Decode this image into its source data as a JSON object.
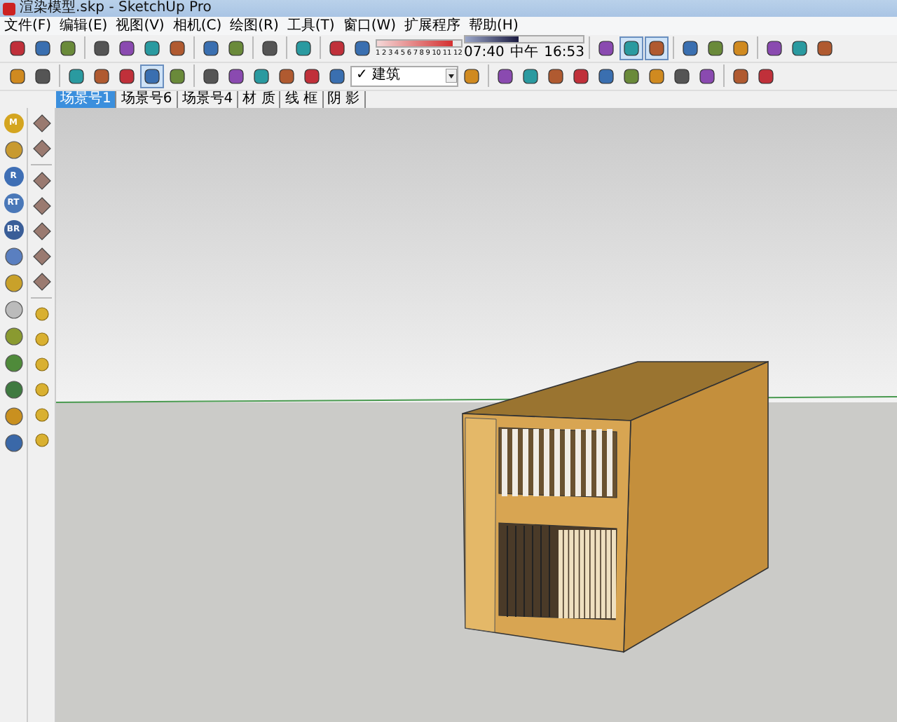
{
  "window": {
    "title": "渲染模型.skp - SketchUp Pro"
  },
  "menu": [
    "文件(F)",
    "编辑(E)",
    "视图(V)",
    "相机(C)",
    "绘图(R)",
    "工具(T)",
    "窗口(W)",
    "扩展程序",
    "帮助(H)"
  ],
  "toolbar_1": [
    {
      "kind": "button",
      "pressed": false
    },
    {
      "kind": "button",
      "pressed": false
    },
    {
      "kind": "button",
      "pressed": false
    },
    {
      "kind": "separator"
    },
    {
      "kind": "button",
      "pressed": false
    },
    {
      "kind": "button",
      "pressed": false
    },
    {
      "kind": "button",
      "pressed": false
    },
    {
      "kind": "button",
      "pressed": false
    },
    {
      "kind": "separator"
    },
    {
      "kind": "button",
      "pressed": false
    },
    {
      "kind": "button",
      "pressed": false
    },
    {
      "kind": "separator"
    },
    {
      "kind": "button",
      "pressed": false
    },
    {
      "kind": "separator"
    },
    {
      "kind": "button",
      "pressed": false
    },
    {
      "kind": "separator"
    },
    {
      "kind": "button",
      "pressed": false
    },
    {
      "kind": "button",
      "pressed": false
    },
    {
      "kind": "month_slider",
      "level": 0.9,
      "labels": [
        "1",
        "2",
        "3",
        "4",
        "5",
        "6",
        "7",
        "8",
        "9",
        "10",
        "11",
        "12"
      ]
    },
    {
      "kind": "time_slider",
      "level": 0.45,
      "readings": [
        "07:40",
        "中午",
        "16:53"
      ]
    },
    {
      "kind": "separator"
    },
    {
      "kind": "button",
      "pressed": false
    },
    {
      "kind": "button",
      "pressed": true
    },
    {
      "kind": "button",
      "pressed": true
    },
    {
      "kind": "separator"
    },
    {
      "kind": "button",
      "pressed": false
    },
    {
      "kind": "button",
      "pressed": false
    },
    {
      "kind": "button",
      "pressed": false
    },
    {
      "kind": "separator"
    },
    {
      "kind": "button",
      "pressed": false
    },
    {
      "kind": "button",
      "pressed": false
    },
    {
      "kind": "button",
      "pressed": false
    }
  ],
  "toolbar_2": [
    {
      "kind": "button",
      "pressed": false
    },
    {
      "kind": "button",
      "pressed": false
    },
    {
      "kind": "separator"
    },
    {
      "kind": "button",
      "pressed": false
    },
    {
      "kind": "button",
      "pressed": false
    },
    {
      "kind": "button",
      "pressed": false
    },
    {
      "kind": "button",
      "pressed": true
    },
    {
      "kind": "button",
      "pressed": false
    },
    {
      "kind": "separator"
    },
    {
      "kind": "button",
      "pressed": false
    },
    {
      "kind": "button",
      "pressed": false
    },
    {
      "kind": "button",
      "pressed": false
    },
    {
      "kind": "button",
      "pressed": false
    },
    {
      "kind": "button",
      "pressed": false
    },
    {
      "kind": "button",
      "pressed": false
    },
    {
      "kind": "layer_dropdown",
      "check": "✓",
      "value": "建筑"
    },
    {
      "kind": "button",
      "pressed": false
    },
    {
      "kind": "separator"
    },
    {
      "kind": "button",
      "pressed": false
    },
    {
      "kind": "button",
      "pressed": false
    },
    {
      "kind": "button",
      "pressed": false
    },
    {
      "kind": "button",
      "pressed": false
    },
    {
      "kind": "button",
      "pressed": false
    },
    {
      "kind": "button",
      "pressed": false
    },
    {
      "kind": "button",
      "pressed": false
    },
    {
      "kind": "button",
      "pressed": false
    },
    {
      "kind": "button",
      "pressed": false
    },
    {
      "kind": "separator"
    },
    {
      "kind": "button",
      "pressed": false
    },
    {
      "kind": "button",
      "pressed": false
    }
  ],
  "scene_tabs": [
    {
      "label": "场景号1",
      "selected": true
    },
    {
      "label": "场景号6",
      "selected": false
    },
    {
      "label": "场景号4",
      "selected": false
    },
    {
      "label": "材 质",
      "selected": false
    },
    {
      "label": "线 框",
      "selected": false
    },
    {
      "label": "阴 影",
      "selected": false
    }
  ],
  "left_toolbar_1": [
    {
      "kind": "lettered",
      "label": "M"
    },
    {
      "kind": "glyph"
    },
    {
      "kind": "lettered",
      "label": "R"
    },
    {
      "kind": "lettered",
      "label": "RT"
    },
    {
      "kind": "lettered",
      "label": "BR"
    },
    {
      "kind": "glyph"
    },
    {
      "kind": "glyph"
    },
    {
      "kind": "glyph"
    },
    {
      "kind": "glyph"
    },
    {
      "kind": "glyph"
    },
    {
      "kind": "glyph"
    },
    {
      "kind": "glyph"
    },
    {
      "kind": "glyph"
    }
  ],
  "left_toolbar_2": [
    {
      "kind": "glyph"
    },
    {
      "kind": "glyph"
    },
    {
      "kind": "separator"
    },
    {
      "kind": "glyph"
    },
    {
      "kind": "glyph"
    },
    {
      "kind": "glyph"
    },
    {
      "kind": "glyph"
    },
    {
      "kind": "glyph"
    },
    {
      "kind": "separator"
    },
    {
      "kind": "glyph"
    },
    {
      "kind": "glyph"
    },
    {
      "kind": "glyph"
    },
    {
      "kind": "glyph"
    },
    {
      "kind": "glyph"
    },
    {
      "kind": "glyph"
    }
  ]
}
